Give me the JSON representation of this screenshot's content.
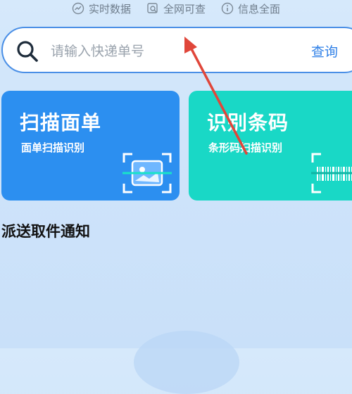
{
  "features": [
    {
      "icon": "trend-icon",
      "label": "实时数据"
    },
    {
      "icon": "globe-search-icon",
      "label": "全网可查"
    },
    {
      "icon": "info-icon",
      "label": "信息全面"
    }
  ],
  "search": {
    "placeholder": "请输入快递单号",
    "button_label": "查询"
  },
  "cards": {
    "scan": {
      "title": "扫描面单",
      "subtitle": "面单扫描识别",
      "icon": "scan-photo-icon",
      "color": "#2c8ff0"
    },
    "barcode": {
      "title": "识别条码",
      "subtitle": "条形码扫描识别",
      "icon": "barcode-scan-icon",
      "color": "#19d8c6"
    }
  },
  "section": {
    "title": "派送取件通知"
  },
  "colors": {
    "accent": "#2f80e7",
    "annotation_arrow": "#e0463a"
  }
}
